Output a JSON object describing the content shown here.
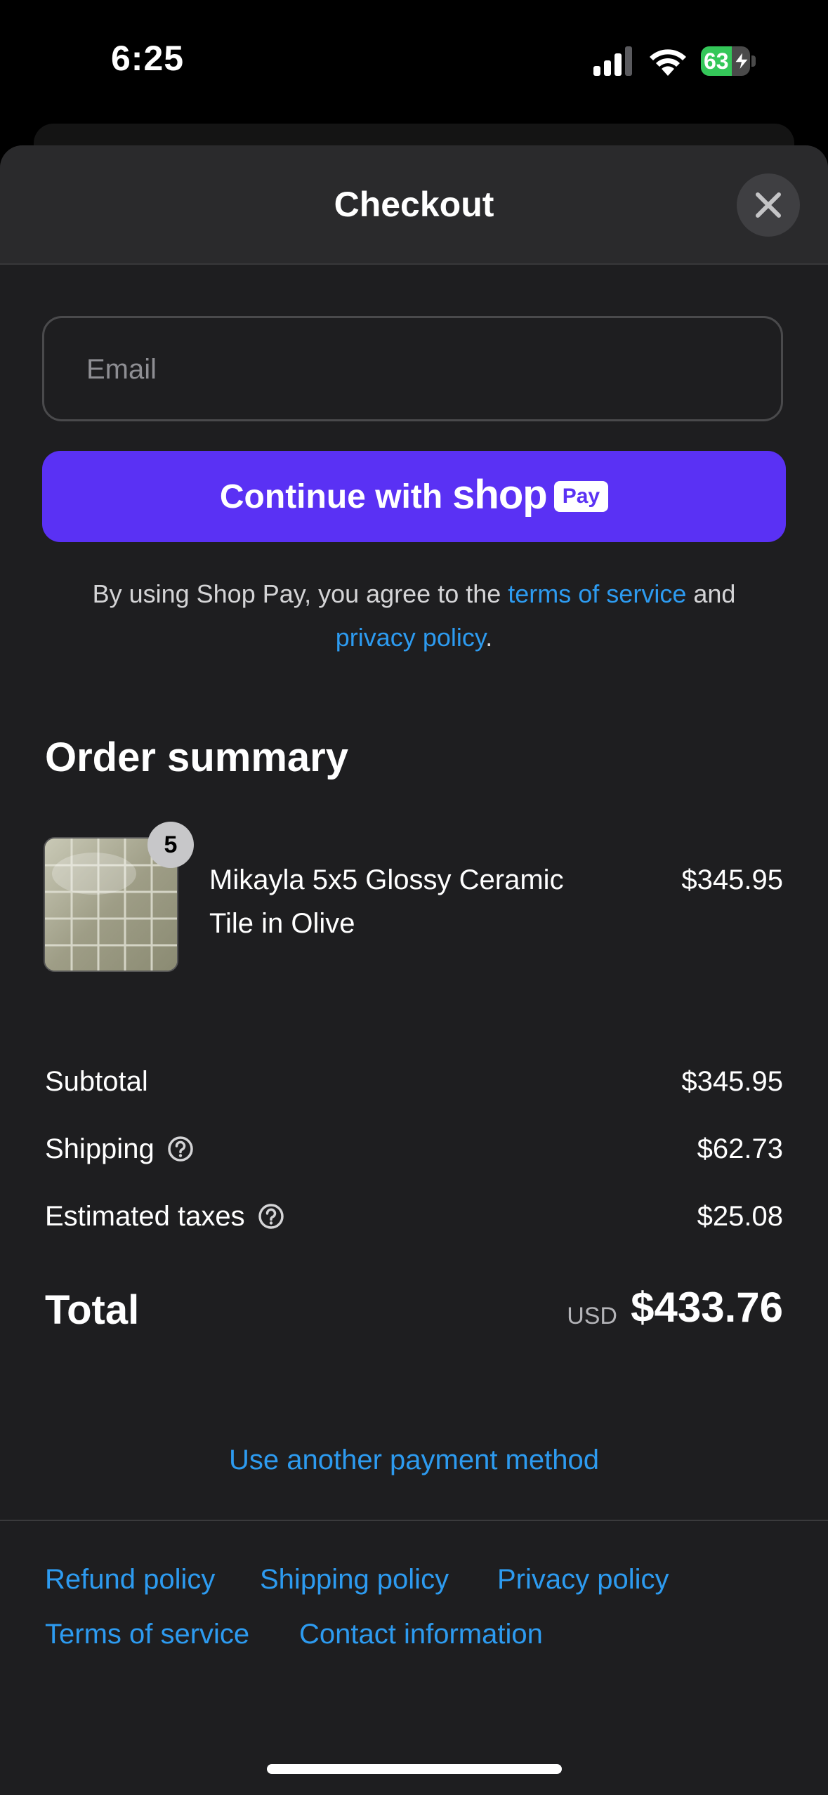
{
  "status_bar": {
    "time": "6:25",
    "battery": "63",
    "battery_level": 0.63,
    "charging": true
  },
  "sheet": {
    "title": "Checkout"
  },
  "email": {
    "placeholder": "Email",
    "value": ""
  },
  "shop_pay": {
    "prefix": "Continue with",
    "brand": "shop",
    "badge": "Pay",
    "color": "#5a31f4"
  },
  "legal": {
    "text1": "By using Shop Pay, you agree to the ",
    "terms_link": "terms of service",
    "text2": " and ",
    "privacy_link": "privacy policy",
    "text3": "."
  },
  "order_summary": {
    "title": "Order summary",
    "items": [
      {
        "quantity": "5",
        "name": "Mikayla 5x5 Glossy Ceramic Tile in Olive",
        "price": "$345.95",
        "image": "olive-ceramic-tile"
      }
    ],
    "subtotal_label": "Subtotal",
    "subtotal": "$345.95",
    "shipping_label": "Shipping",
    "shipping": "$62.73",
    "taxes_label": "Estimated taxes",
    "taxes": "$25.08",
    "total_label": "Total",
    "currency": "USD",
    "total": "$433.76"
  },
  "another_payment": "Use another payment method",
  "footer": {
    "links": [
      "Refund policy",
      "Shipping policy",
      "Privacy policy",
      "Terms of service",
      "Contact information"
    ]
  },
  "colors": {
    "link": "#2d9bf0",
    "background": "#1e1e20",
    "header": "#2a2a2c"
  }
}
